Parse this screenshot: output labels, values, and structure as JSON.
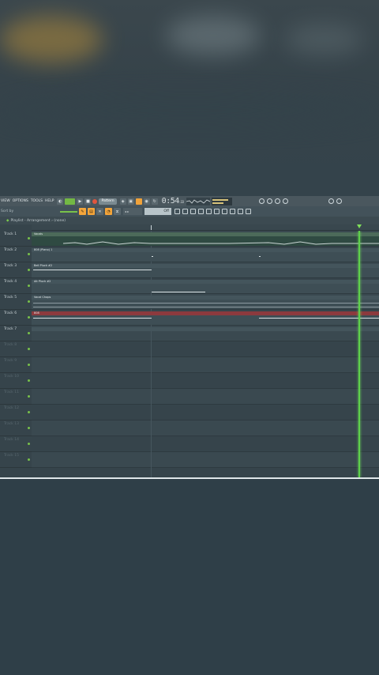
{
  "menu": [
    "VIEW",
    "OPTIONS",
    "TOOLS",
    "HELP"
  ],
  "transport": {
    "pattern_label": "Pattern",
    "time_main": "0:54",
    "time_small": ":33"
  },
  "hint_text": "Sort by",
  "field_value": "Off",
  "playlist": {
    "breadcrumb": "Playlist - Arrangement › (none)"
  },
  "tracks": [
    {
      "name": "Track 1",
      "clip": "Vocals"
    },
    {
      "name": "Track 2",
      "clip": "808 (Piano) 1"
    },
    {
      "name": "Track 3",
      "clip": "Bell Pluck #2"
    },
    {
      "name": "Track 4",
      "clip": "Alt Pluck #2"
    },
    {
      "name": "Track 5",
      "clip": "Vocal Chops"
    },
    {
      "name": "Track 6",
      "clip": "808"
    },
    {
      "name": "Track 7",
      "clip": ""
    },
    {
      "name": "Track 8",
      "clip": ""
    },
    {
      "name": "Track 9",
      "clip": ""
    },
    {
      "name": "Track 10",
      "clip": ""
    },
    {
      "name": "Track 11",
      "clip": ""
    },
    {
      "name": "Track 12",
      "clip": ""
    },
    {
      "name": "Track 13",
      "clip": ""
    },
    {
      "name": "Track 14",
      "clip": ""
    },
    {
      "name": "Track 15",
      "clip": ""
    }
  ],
  "colors": {
    "accent_green": "#5ed14a",
    "accent_orange": "#f4a53a",
    "clip_red": "#c24a4a"
  }
}
